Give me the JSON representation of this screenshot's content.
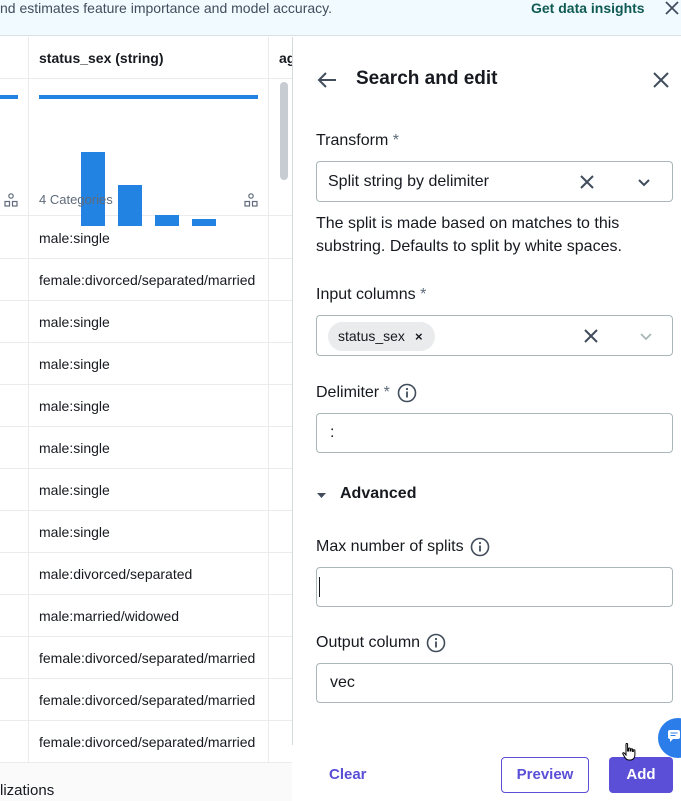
{
  "banner": {
    "text": "nd estimates feature importance and model accuracy.",
    "link": "Get data insights"
  },
  "table": {
    "columns": [
      {
        "label": "status_sex (string)"
      },
      {
        "label": "ag"
      }
    ],
    "histogram_caption": "4 Categories",
    "histogram_values": [
      1.0,
      0.56,
      0.15,
      0.09
    ],
    "rows": [
      "male:single",
      "female:divorced/separated/married",
      "male:single",
      "male:single",
      "male:single",
      "male:single",
      "male:single",
      "male:single",
      "male:divorced/separated",
      "male:married/widowed",
      "female:divorced/separated/married",
      "female:divorced/separated/married",
      "female:divorced/separated/married"
    ],
    "bottom_text": "lizations"
  },
  "panel": {
    "title": "Search and edit",
    "transform_label": "Transform",
    "required_mark": "*",
    "transform_value": "Split string by delimiter",
    "help_text": "The split is made based on matches to this substring. Defaults to split by white spaces.",
    "input_columns_label": "Input columns",
    "input_token": "status_sex",
    "token_remove": "×",
    "delimiter_label": "Delimiter",
    "delimiter_value": ":",
    "advanced_label": "Advanced",
    "max_splits_label": "Max number of splits",
    "max_splits_value": "",
    "output_column_label": "Output column",
    "output_column_value": "vec",
    "clear_label": "Clear",
    "preview_label": "Preview",
    "add_label": "Add"
  },
  "colors": {
    "accent": "#5a4fd6",
    "histogram": "#2383e2",
    "banner_link": "#0f5b53"
  }
}
